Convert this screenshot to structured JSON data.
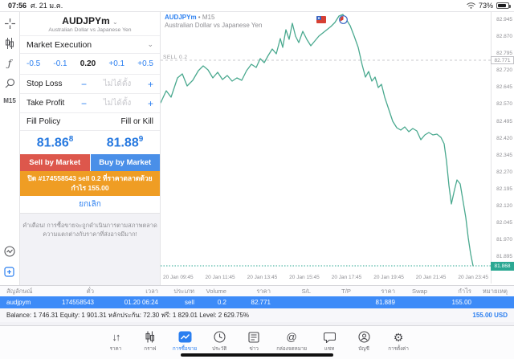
{
  "status_bar": {
    "time": "07:56",
    "date": "ศ. 21 ม.ค.",
    "battery": "73%"
  },
  "toolbar": {
    "timeframe": "M15"
  },
  "order_panel": {
    "symbol": "AUDJPYm",
    "symbol_chevron": "⌄",
    "symbol_description": "Australian Dollar vs Japanese Yen",
    "execution_mode": "Market Execution",
    "execution_chevron": "⌄",
    "volume": {
      "minus_large": "-0.5",
      "minus_small": "-0.1",
      "value": "0.20",
      "plus_small": "+0.1",
      "plus_large": "+0.5"
    },
    "stop_loss": {
      "label": "Stop Loss",
      "minus": "−",
      "placeholder": "ไม่ได้ตั้ง",
      "plus": "+"
    },
    "take_profit": {
      "label": "Take Profit",
      "minus": "−",
      "placeholder": "ไม่ได้ตั้ง",
      "plus": "+"
    },
    "fill_policy": {
      "label": "Fill Policy",
      "value": "Fill or Kill"
    },
    "sell_price": {
      "main": "81.86",
      "sup": "8"
    },
    "buy_price": {
      "main": "81.88",
      "sup": "9"
    },
    "sell_button": "Sell by Market",
    "buy_button": "Buy by Market",
    "close_banner_line1": "ปิด #174558543 sell 0.2 ที่ราคาตลาดด้วย",
    "close_banner_line2": "กำไร 155.00",
    "cancel_label": "ยกเลิก",
    "warning_line1": "คำเตือน! การซื้อขายจะถูกดำเนินการตามสภาพตลาด",
    "warning_line2": "ความแตกต่างกับราคาที่ส่งอาจมีมาก!"
  },
  "chart": {
    "title": "AUDJPYm",
    "title_suffix": " • M15",
    "subtitle": "Australian Dollar vs Japanese Yen",
    "sell_line_label": "SELL 0.2",
    "sell_line_price": "82.771",
    "current_price": "81.868",
    "line_color": "#4aa98f",
    "line_points": "0,113 7,98 13,106 21,82 27,77 33,92 40,85 47,73 53,67 59,72 65,82 71,75 77,84 83,79 89,86 95,82 101,85 107,73 113,65 119,69 124,58 129,63 134,54 139,46 144,52 149,33 152,44 156,22 160,34 164,14 168,30 172,38 177,24 182,34 187,42 192,36 197,30 202,26 207,22 212,18 217,13 222,5 227,3 231,9 236,17 241,30 246,44 251,66 255,81 259,74 263,86 267,81 271,94 275,90 279,106 284,121 289,136 294,144 299,147 304,143 309,149 314,145 319,148 324,159 329,153 334,150 339,153 344,152 349,156 353,164 356,186 359,216 362,239 366,221 369,209 373,214 377,238 380,256 383,281 386,301 389,316",
    "price_axis": [
      "82.945",
      "82.870",
      "82.795",
      "82.720",
      "82.645",
      "82.570",
      "82.495",
      "82.420",
      "82.345",
      "82.270",
      "82.195",
      "82.120",
      "82.045",
      "81.970",
      "81.895"
    ],
    "time_axis": [
      "20 Jan 09:45",
      "20 Jan 11:45",
      "20 Jan 13:45",
      "20 Jan 15:45",
      "20 Jan 17:45",
      "20 Jan 19:45",
      "20 Jan 21:45",
      "20 Jan 23:45"
    ]
  },
  "positions_table": {
    "headers": [
      "สัญลักษณ์",
      "ตั๋ว",
      "เวลา",
      "ประเภท",
      "Volume",
      "ราคา",
      "S/L",
      "T/P",
      "ราคา",
      "Swap",
      "กำไร",
      "หมายเหตุ"
    ],
    "row": {
      "symbol": "audjpym",
      "ticket": "174558543",
      "time": "01.20 06:24",
      "type": "sell",
      "volume": "0.2",
      "price_open": "82.771",
      "sl": "",
      "tp": "",
      "price_current": "81.889",
      "swap": "",
      "profit": "155.00",
      "note": ""
    },
    "summary": {
      "text": "Balance: 1 746.31 Equity: 1 901.31 หลักประกัน: 72.30 ฟรี: 1 829.01 Level: 2 629.75%",
      "total": "155.00  USD"
    }
  },
  "bottom_nav": {
    "items": [
      {
        "label": "ราคา"
      },
      {
        "label": "กราฟ"
      },
      {
        "label": "การซื้อขาย"
      },
      {
        "label": "ประวัติ"
      },
      {
        "label": "ข่าว"
      },
      {
        "label": "กล่องจดหมาย"
      },
      {
        "label": "แชท"
      },
      {
        "label": "บัญชี"
      },
      {
        "label": "การตั้งค่า"
      }
    ]
  },
  "colors": {
    "accent_blue": "#2b7ff0",
    "sell_red": "#dd574c",
    "buy_blue": "#4a8fe8",
    "banner_orange": "#ef9d24",
    "row_blue": "#3d8bf8",
    "chart_line": "#4aa98f",
    "current_price_teal": "#2ca893"
  }
}
